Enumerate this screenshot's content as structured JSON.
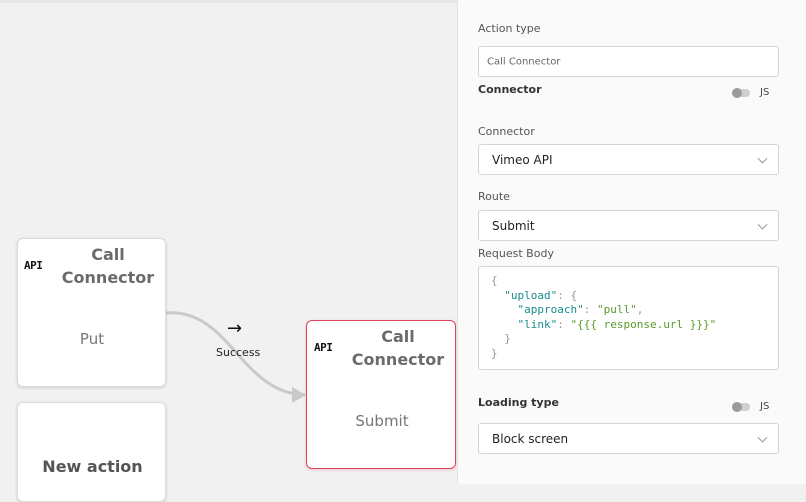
{
  "canvas": {
    "nodes": [
      {
        "icon": "API",
        "title": "Call Connector",
        "subtitle": "Put"
      },
      {
        "icon": "API",
        "title": "Call Connector",
        "subtitle": "Submit"
      },
      {
        "title": "New action"
      }
    ],
    "edge": {
      "label": "Success"
    }
  },
  "panel": {
    "action_type": {
      "label": "Action type",
      "value": "Call Connector"
    },
    "connector_section": {
      "label": "Connector",
      "toggle_label": "JS"
    },
    "connector": {
      "label": "Connector",
      "value": "Vimeo API"
    },
    "route": {
      "label": "Route",
      "value": "Submit"
    },
    "request_body": {
      "label": "Request Body",
      "lines": [
        "{",
        "  \"upload\": {",
        "    \"approach\": \"pull\",",
        "    \"link\": \"{{{ response.url }}}\"",
        "  }",
        "}"
      ]
    },
    "loading_section": {
      "label": "Loading type",
      "toggle_label": "JS"
    },
    "loading_type": {
      "value": "Block screen"
    }
  },
  "colors": {
    "selected_border": "#e0435c",
    "json_key": "#1a8c8c",
    "json_string": "#5a9a2a"
  }
}
